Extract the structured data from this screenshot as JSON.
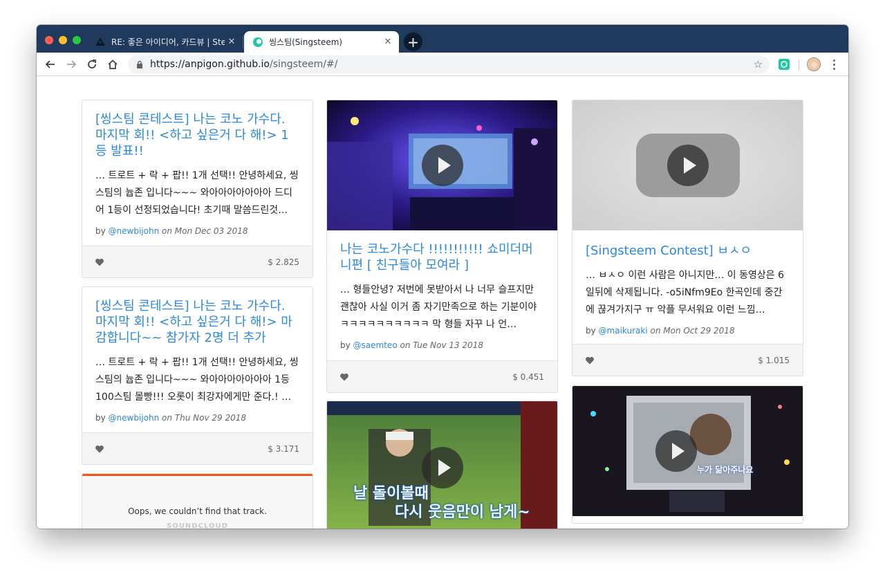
{
  "browser": {
    "tabs": [
      {
        "title": "RE: 좋은 아이디어, 카드뷰 | Steemit",
        "close": "✕"
      },
      {
        "title": "씽스팀(Singsteem)",
        "close": "✕"
      }
    ],
    "new_tab": "+",
    "url_host": "https://anpigon.github.io",
    "url_path": "/singsteem/#/"
  },
  "cards": [
    {
      "title": "[씽스팀 콘테스트] 나는 코노 가수다. 마지막 회!! <하고 싶은거 다 해!> 1등 발표!!",
      "excerpt": "… 트로트 + 락 + 팝!! 1개 선택!! 안녕하세요, 씽스팀의 늅존 입니다~~~ 와아아아아아아아 드디어 1등이 선정되었습니다! 초기때 말씀드린것…",
      "by": "by",
      "author": "@newbijohn",
      "date": "on Mon Dec 03 2018",
      "payout": "$ 2.825"
    },
    {
      "title": "[씽스팀 콘테스트] 나는 코노 가수다. 마지막 회!! <하고 싶은거 다 해!> 마감합니다~~ 참가자 2명 더 추가",
      "excerpt": "… 트로트 + 락 + 팝!! 1개 선택!! 안녕하세요, 씽스팀의 늅존 입니다~~~ 와아아아아아아아 1등 100스팀 몰빵!!! 오롯이 최강자에게만 준다.! …",
      "by": "by",
      "author": "@newbijohn",
      "date": "on Thu Nov 29 2018",
      "payout": "$ 3.171"
    },
    {
      "title": "나는 코노가수다 !!!!!!!!!!! 쇼미더머니편 [ 친구들아 모여라 ]",
      "excerpt": "… 형들안녕? 저번에 못받아서 나 너무 슬프지만 괜찮아 사실 이거 좀 자기만족으로 하는 기분이야 ㅋㅋㅋㅋㅋㅋㅋㅋㅋㅋ 막 형들 자꾸 나 언…",
      "by": "by",
      "author": "@saemteo",
      "date": "on Tue Nov 13 2018",
      "payout": "$ 0.451"
    },
    {
      "title": "[Singsteem Contest] ㅂㅅㅇ",
      "excerpt": "… ㅂㅅㅇ 이런 사람은 아니지만… 이 동영상은 6일뒤에 삭제됩니다. -o5iNfm9Eo 한곡인데 중간에 끊겨가지구 ㅠ 악플 무서워요 이런 느낌…",
      "by": "by",
      "author": "@maikuraki",
      "date": "on Mon Oct 29 2018",
      "payout": "$ 1.015"
    }
  ],
  "soundcloud": {
    "message": "Oops, we couldn’t find that track.",
    "logo": "SOUNDCLOUD"
  },
  "video_lyrics": {
    "video2": [
      "날 돌이볼때",
      "다시 웃음만이 남게~"
    ],
    "video3": [
      "누가 닮아주나요"
    ]
  },
  "colors": {
    "titlebar": "#1f3a5c",
    "link": "#2a88e0",
    "soundcloud": "#f2541b"
  }
}
